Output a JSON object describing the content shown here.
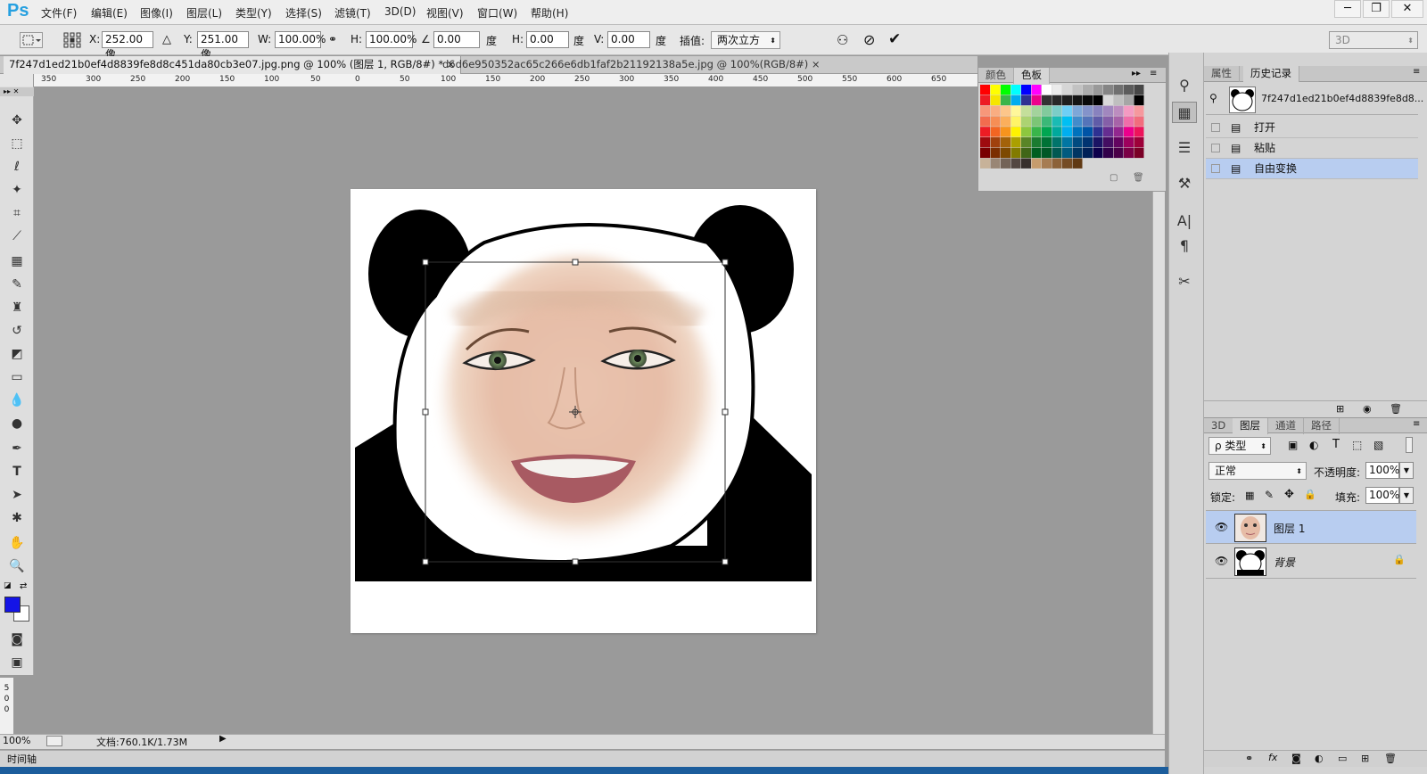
{
  "app": {
    "logo": "Ps"
  },
  "menus": [
    "文件(F)",
    "编辑(E)",
    "图像(I)",
    "图层(L)",
    "类型(Y)",
    "选择(S)",
    "滤镜(T)",
    "3D(D)",
    "视图(V)",
    "窗口(W)",
    "帮助(H)"
  ],
  "window_buttons": [
    "─",
    "❐",
    "✕"
  ],
  "options": {
    "x_label": "X:",
    "x_value": "252.00 像",
    "y_label": "Y:",
    "y_value": "251.00 像",
    "w_label": "W:",
    "w_value": "100.00%",
    "h_label": "H:",
    "h_value": "100.00%",
    "angle_value": "0.00",
    "angle_unit": "度",
    "hskew_label": "H:",
    "hskew_value": "0.00",
    "hskew_unit": "度",
    "vskew_label": "V:",
    "vskew_value": "0.00",
    "vskew_unit": "度",
    "interp_label": "插值:",
    "interp_value": "两次立方",
    "workspace": "3D"
  },
  "tabs": [
    {
      "label": "7f247d1ed21b0ef4d8839fe8d8c451da80cb3e07.jpg.png @ 100% (图层 1, RGB/8#) *",
      "close": "×"
    },
    {
      "label": "d6d6e950352ac65c266e6db1faf2b21192138a5e.jpg @ 100%(RGB/8#)",
      "close": "×"
    }
  ],
  "ruler_ticks": [
    "350",
    "300",
    "250",
    "200",
    "150",
    "100",
    "50",
    "0",
    "50",
    "100",
    "150",
    "200",
    "250",
    "300",
    "350",
    "400",
    "450",
    "500",
    "550",
    "600",
    "650"
  ],
  "vruler_ticks": [
    "5",
    "0",
    "0"
  ],
  "status": {
    "zoom": "100%",
    "doc": "文档:760.1K/1.73M"
  },
  "timeline": {
    "label": "时间轴"
  },
  "swatch_panel": {
    "tabs": [
      "颜色",
      "色板"
    ]
  },
  "right_panel": {
    "top_tabs": [
      "属性",
      "历史记录"
    ],
    "snapshot_name": "7f247d1ed21b0ef4d8839fe8d8...",
    "history": [
      "打开",
      "粘贴",
      "自由变换"
    ],
    "layer_tabs": [
      "3D",
      "图层",
      "通道",
      "路径"
    ],
    "kind_filter": "ρ 类型",
    "blend_mode": "正常",
    "opacity_label": "不透明度:",
    "opacity_value": "100%",
    "lock_label": "锁定:",
    "fill_label": "填充:",
    "fill_value": "100%",
    "layers": [
      {
        "name": "图层 1"
      },
      {
        "name": "背景"
      }
    ]
  },
  "colors": {
    "accent": "#26a0e0",
    "selected_row": "#b8cdf0",
    "foreground": "#1414e6",
    "background": "#ffffff"
  },
  "icons": [
    "move-tool-icon",
    "marquee-tool-icon",
    "lasso-tool-icon",
    "quick-select-icon",
    "crop-tool-icon",
    "eyedropper-icon",
    "healing-brush-icon",
    "brush-tool-icon",
    "clone-stamp-icon",
    "history-brush-icon",
    "eraser-icon",
    "gradient-icon",
    "blur-icon",
    "dodge-icon",
    "pen-tool-icon",
    "type-tool-icon",
    "path-select-icon",
    "shape-tool-icon",
    "hand-tool-icon",
    "zoom-tool-icon"
  ]
}
